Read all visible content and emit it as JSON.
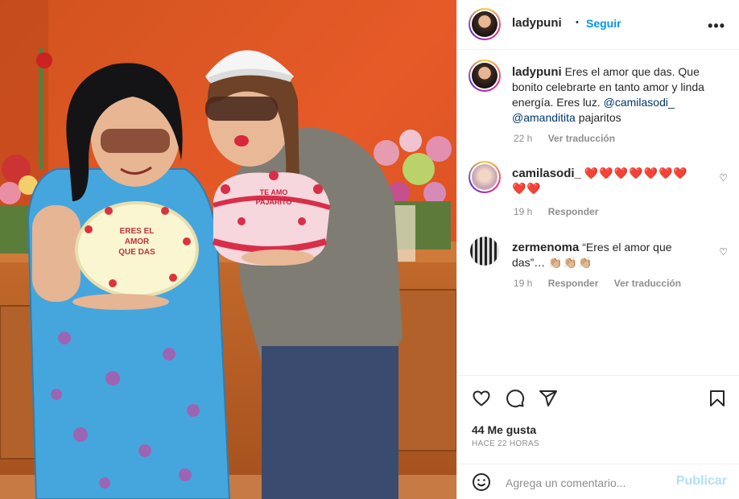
{
  "header": {
    "username": "ladypuni",
    "separator": "•",
    "follow_label": "Seguir",
    "more_label": "•••"
  },
  "caption": {
    "username": "ladypuni",
    "text": "Eres el amor que das. Que bonito celebrarte en tanto amor y linda energía. Eres luz.",
    "mention1": "@camilasodi_",
    "mention2": "@amanditita",
    "tail": "pajaritos",
    "time": "22 h",
    "translate": "Ver traducción"
  },
  "comments": [
    {
      "username": "camilasodi_",
      "text": "❤️❤️❤️❤️❤️❤️❤️❤️❤️",
      "time": "19 h",
      "reply": "Responder",
      "translate": ""
    },
    {
      "username": "zermenoma",
      "text": "“Eres el amor que das”…",
      "emoji": "👏🏼👏🏼👏🏼",
      "time": "19 h",
      "reply": "Responder",
      "translate": "Ver traducción"
    }
  ],
  "actions": {
    "like_icon": "heart-icon",
    "comment_icon": "comment-icon",
    "share_icon": "paper-plane-icon",
    "save_icon": "bookmark-icon"
  },
  "stats": {
    "likes": "44 Me gusta",
    "ago": "HACE 22 HORAS"
  },
  "composer": {
    "placeholder": "Agrega un comentario...",
    "publish": "Publicar",
    "emoji_icon": "smiley-icon"
  },
  "photo": {
    "cake1_text": "ERES EL AMOR QUE DAS",
    "cake2_text": "TE AMO PAJARITO"
  },
  "colors": {
    "accent": "#0095f6",
    "like_red": "#ed4956",
    "wall": "#e0582c"
  }
}
